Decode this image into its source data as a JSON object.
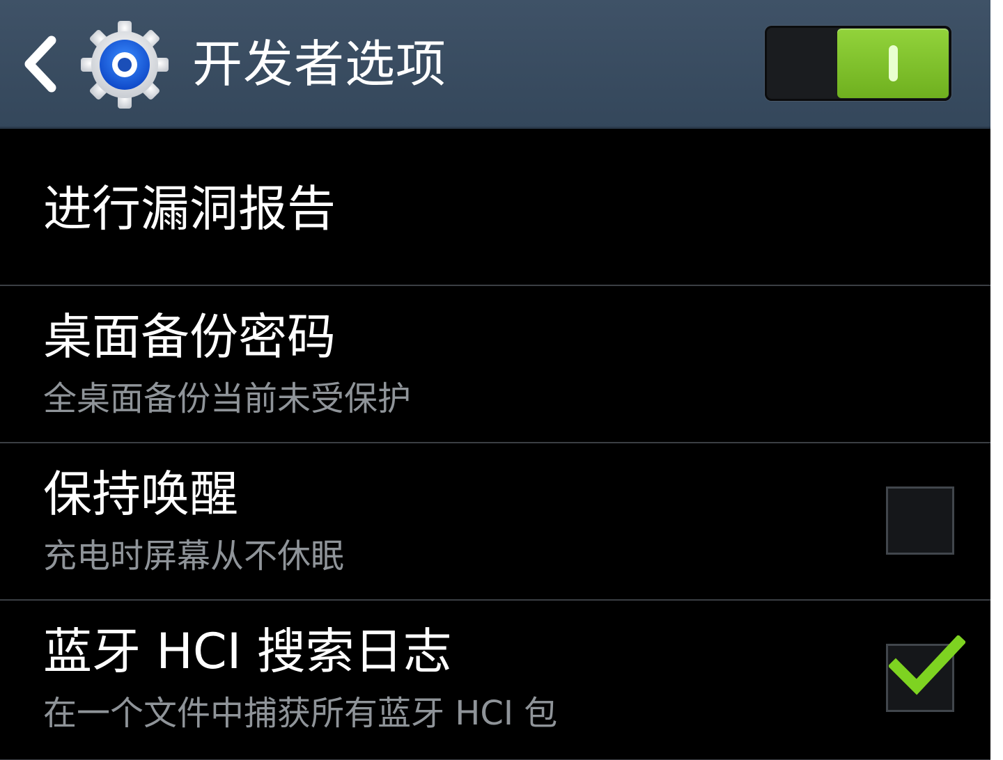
{
  "header": {
    "title": "开发者选项",
    "back_icon": "chevron-left-icon",
    "settings_icon": "gear-icon",
    "master_switch_on": true
  },
  "colors": {
    "action_bar": "#3a4d62",
    "switch_on": "#7cc22a",
    "check": "#7ed321",
    "secondary_text": "#8f9499"
  },
  "items": [
    {
      "title": "进行漏洞报告",
      "summary": ""
    },
    {
      "title": "桌面备份密码",
      "summary": "全桌面备份当前未受保护"
    },
    {
      "title": "保持唤醒",
      "summary": "充电时屏幕从不休眠",
      "checked": false
    },
    {
      "title": "蓝牙 HCI 搜索日志",
      "summary": "在一个文件中捕获所有蓝牙 HCI 包",
      "checked": true
    }
  ]
}
